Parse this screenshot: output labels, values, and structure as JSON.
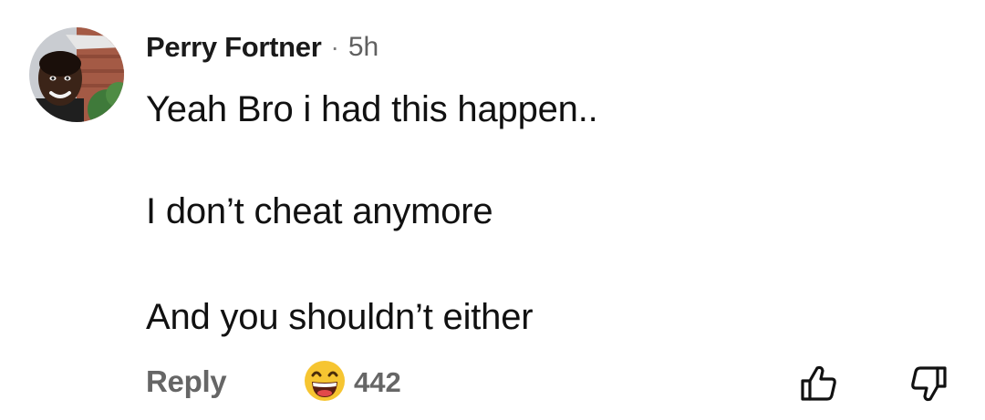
{
  "comment": {
    "author": "Perry Fortner",
    "separator": "·",
    "time": "5h",
    "lines": [
      "Yeah Bro i had this happen..",
      "I don’t cheat anymore",
      "And you shouldn’t either"
    ]
  },
  "actions": {
    "reply_label": "Reply",
    "reaction_icon": "laughing-emoji-icon",
    "reaction_count": "442",
    "like_icon": "thumbs-up-icon",
    "dislike_icon": "thumbs-down-icon"
  },
  "colors": {
    "text": "#111111",
    "muted": "#666666",
    "emoji_face": "#F6C531"
  }
}
